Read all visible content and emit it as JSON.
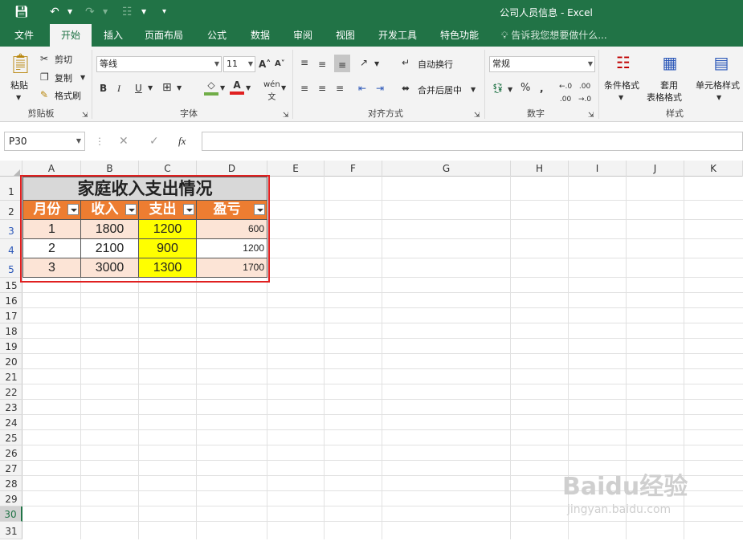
{
  "window": {
    "title": "公司人员信息 - Excel"
  },
  "tabs": [
    "文件",
    "开始",
    "插入",
    "页面布局",
    "公式",
    "数据",
    "审阅",
    "视图",
    "开发工具",
    "特色功能"
  ],
  "tell_me": "告诉我您想要做什么...",
  "ribbon": {
    "clipboard": {
      "paste": "粘贴",
      "cut": "剪切",
      "copy": "复制",
      "format_painter": "格式刷",
      "label": "剪贴板"
    },
    "font": {
      "name": "等线",
      "size": "11",
      "label": "字体"
    },
    "alignment": {
      "wrap": "自动换行",
      "merge": "合并后居中",
      "label": "对齐方式"
    },
    "number": {
      "format": "常规",
      "label": "数字"
    },
    "styles": {
      "conditional": "条件格式",
      "table_fmt_1": "套用",
      "table_fmt_2": "表格格式",
      "cell_styles": "单元格样式",
      "label": "样式"
    }
  },
  "formula_bar": {
    "name_box": "P30",
    "fx": "fx",
    "value": ""
  },
  "columns": [
    "A",
    "B",
    "C",
    "D",
    "E",
    "F",
    "G",
    "H",
    "I",
    "J",
    "K"
  ],
  "rows": [
    "1",
    "2",
    "3",
    "4",
    "5",
    "15",
    "16",
    "17",
    "18",
    "19",
    "20",
    "21",
    "22",
    "23",
    "24",
    "25",
    "26",
    "27",
    "28",
    "29",
    "30",
    "31"
  ],
  "table": {
    "title": "家庭收入支出情况",
    "headers": [
      "月份",
      "收入",
      "支出",
      "盈亏"
    ],
    "rows": [
      [
        "1",
        "1800",
        "1200",
        "600"
      ],
      [
        "2",
        "2100",
        "900",
        "1200"
      ],
      [
        "3",
        "3000",
        "1300",
        "1700"
      ]
    ]
  },
  "colors": {
    "excel_green": "#217346",
    "header_orange": "#ed7d31",
    "highlight_yellow": "#ffff00",
    "row_band": "#fce4d6",
    "selection_border": "#e02020"
  },
  "watermark": {
    "brand": "Baidu经验",
    "url": "jingyan.baidu.com"
  }
}
